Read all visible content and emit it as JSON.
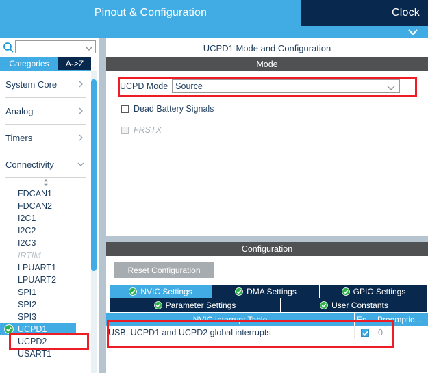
{
  "top_tabs": {
    "pinout_label": "Pinout & Configuration",
    "clock_label": "Clock",
    "expand_icon": "chevron-down-icon"
  },
  "sidebar": {
    "search": {
      "value": "",
      "placeholder": "",
      "icon": "search-icon",
      "dropdown_icon": "chevron-down-icon"
    },
    "tabs": [
      {
        "label": "Categories",
        "active": true
      },
      {
        "label": "A->Z",
        "active": false
      }
    ],
    "categories": [
      {
        "label": "System Core",
        "state": "collapsed",
        "icon": "chevron-right-icon"
      },
      {
        "label": "Analog",
        "state": "collapsed",
        "icon": "chevron-right-icon"
      },
      {
        "label": "Timers",
        "state": "collapsed",
        "icon": "chevron-right-icon"
      },
      {
        "label": "Connectivity",
        "state": "expanded",
        "icon": "chevron-down-icon"
      }
    ],
    "peripherals": [
      {
        "label": "FDCAN1",
        "state": "normal"
      },
      {
        "label": "FDCAN2",
        "state": "normal"
      },
      {
        "label": "I2C1",
        "state": "normal"
      },
      {
        "label": "I2C2",
        "state": "normal"
      },
      {
        "label": "I2C3",
        "state": "normal"
      },
      {
        "label": "IRTIM",
        "state": "disabled"
      },
      {
        "label": "LPUART1",
        "state": "normal"
      },
      {
        "label": "LPUART2",
        "state": "normal"
      },
      {
        "label": "SPI1",
        "state": "normal"
      },
      {
        "label": "SPI2",
        "state": "normal"
      },
      {
        "label": "SPI3",
        "state": "normal"
      },
      {
        "label": "UCPD1",
        "state": "selected",
        "status_icon": "green-check-icon"
      },
      {
        "label": "UCPD2",
        "state": "normal"
      },
      {
        "label": "USART1",
        "state": "normal"
      }
    ]
  },
  "main": {
    "title": "UCPD1 Mode and Configuration",
    "mode": {
      "header": "Mode",
      "ucpd_mode_label": "UCPD Mode",
      "ucpd_mode_value": "Source",
      "ucpd_mode_dropdown_icon": "chevron-down-icon",
      "checkboxes": [
        {
          "label": "Dead Battery Signals",
          "checked": false,
          "disabled": false
        },
        {
          "label": "FRSTX",
          "checked": false,
          "disabled": true
        }
      ]
    },
    "configuration": {
      "header": "Configuration",
      "reset_button": "Reset Configuration",
      "tabs_row1": [
        {
          "label": "NVIC Settings",
          "active": true,
          "icon": "green-check-icon"
        },
        {
          "label": "DMA Settings",
          "active": false,
          "icon": "green-check-icon"
        },
        {
          "label": "GPIO Settings",
          "active": false,
          "icon": "green-check-icon"
        }
      ],
      "tabs_row2": [
        {
          "label": "Parameter Settings",
          "active": false,
          "icon": "green-check-icon"
        },
        {
          "label": "User Constants",
          "active": false,
          "icon": "green-check-icon"
        }
      ],
      "nvic_table": {
        "columns": [
          "NVIC Interrupt Table",
          "En...",
          "Preemptio..."
        ],
        "rows": [
          {
            "name": "USB, UCPD1 and UCPD2 global interrupts",
            "enabled": true,
            "preemption": "0"
          }
        ]
      }
    }
  },
  "colors": {
    "accent_light_blue": "#41ace3",
    "accent_dark_navy": "#09284d",
    "section_header_gray": "#4f5152",
    "splitter_gray": "#b5c4ce",
    "annotation_red": "#ee1c25",
    "status_green": "#2eb24a"
  }
}
